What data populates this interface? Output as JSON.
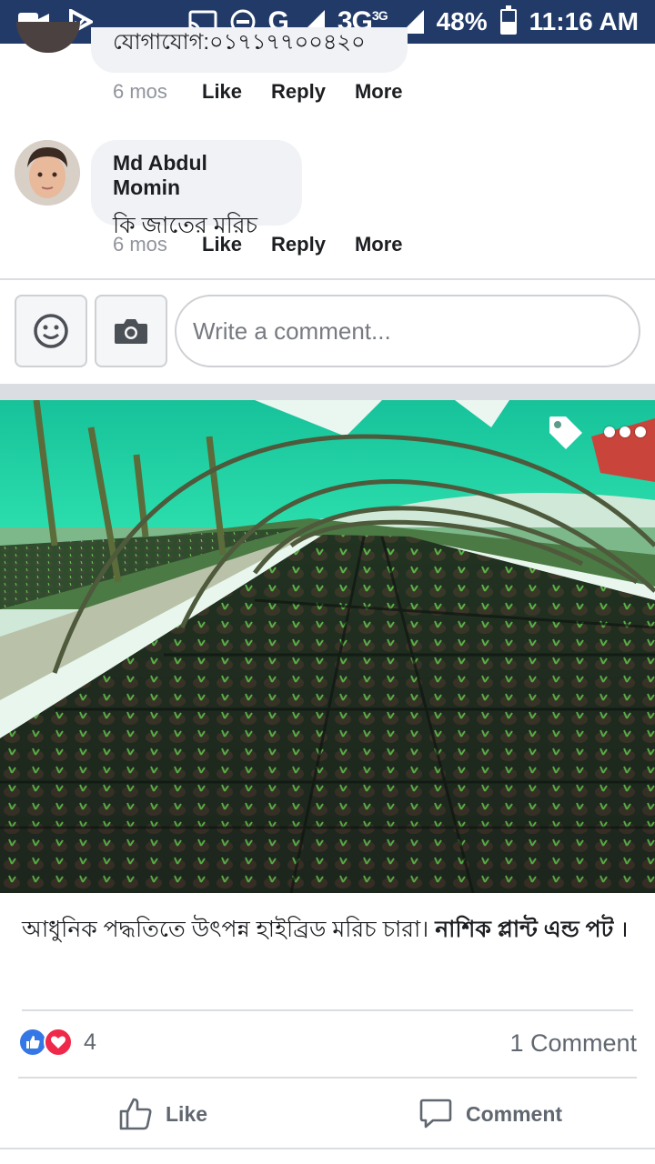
{
  "status_bar": {
    "network": "G",
    "network_3g": "3G",
    "network_3g_sup": "3G",
    "battery": "48%",
    "battery_level": 0.48,
    "time": "11:16 AM"
  },
  "comments": [
    {
      "author": "",
      "text": "যোগাযোগ:০১৭১৭৭০০৪২০",
      "time": "6 mos",
      "actions": [
        "Like",
        "Reply",
        "More"
      ]
    },
    {
      "author": "Md Abdul Momin",
      "text": "কি জাতের মরিচ",
      "time": "6 mos",
      "actions": [
        "Like",
        "Reply",
        "More"
      ]
    }
  ],
  "composer": {
    "placeholder": "Write a comment..."
  },
  "post": {
    "caption_text": "আধুনিক পদ্ধতিতে উৎপন্ন হাইব্রিড মরিচ চারা। ",
    "caption_bold": "নাশিক প্লান্ট এন্ড পট",
    "caption_end": " ।",
    "reaction_count": "4",
    "comment_count": "1 Comment",
    "like_label": "Like",
    "comment_label": "Comment"
  },
  "colors": {
    "status_bar": "#213a68",
    "like_blue": "#3578e5",
    "love_red": "#f0284a",
    "bubble": "#f0f2f5"
  }
}
